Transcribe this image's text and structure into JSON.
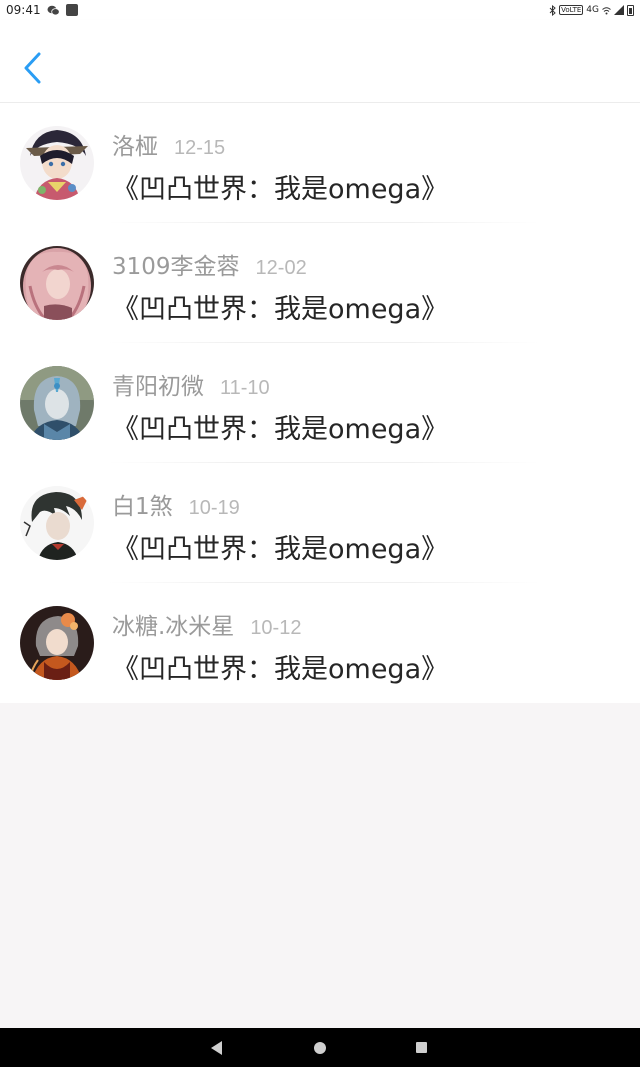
{
  "status_bar": {
    "time": "09:41",
    "left_icons": [
      "wechat-icon",
      "app-square-icon"
    ],
    "right_icons": [
      "bluetooth-icon",
      "volte-icon",
      "network-4g-icon",
      "wifi-icon",
      "signal-icon",
      "battery-icon"
    ],
    "network_label": "4G"
  },
  "header": {
    "back_icon": "chevron-left-icon",
    "accent_color": "#2a9df4"
  },
  "items": [
    {
      "name": "洛桠",
      "date": "12-15",
      "message": "《凹凸世界：我是omega》"
    },
    {
      "name": "3109李金蓉",
      "date": "12-02",
      "message": "《凹凸世界：我是omega》"
    },
    {
      "name": "青阳初微",
      "date": "11-10",
      "message": "《凹凸世界：我是omega》"
    },
    {
      "name": "白1煞",
      "date": "10-19",
      "message": "《凹凸世界：我是omega》"
    },
    {
      "name": "冰糖.冰米星",
      "date": "10-12",
      "message": "《凹凸世界：我是omega》"
    }
  ],
  "nav_bar": {
    "icons": [
      "nav-back-icon",
      "nav-home-icon",
      "nav-recents-icon"
    ]
  }
}
